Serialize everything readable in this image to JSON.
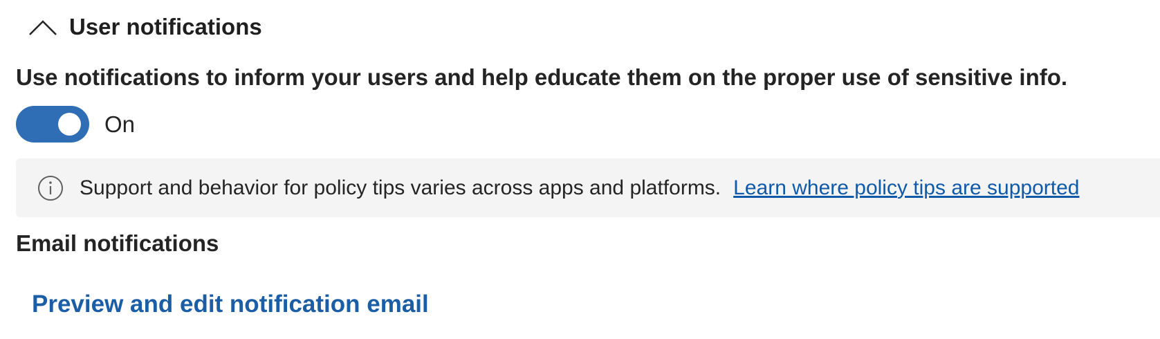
{
  "section": {
    "title": "User notifications",
    "expanded": true,
    "chevron_icon": "chevron-up-icon"
  },
  "description": "Use notifications to inform your users and help educate them on the proper use of sensitive info.",
  "toggle": {
    "state": "on",
    "label": "On",
    "color": "#2f6db5"
  },
  "info_bar": {
    "icon": "info-icon",
    "text": "Support and behavior for policy tips varies across apps and platforms.",
    "link_text": "Learn where policy tips are supported",
    "background": "#f4f4f4",
    "link_color": "#0f5aa8"
  },
  "email": {
    "heading": "Email notifications",
    "link_text": "Preview and edit notification email",
    "link_color": "#1b5ea6"
  }
}
